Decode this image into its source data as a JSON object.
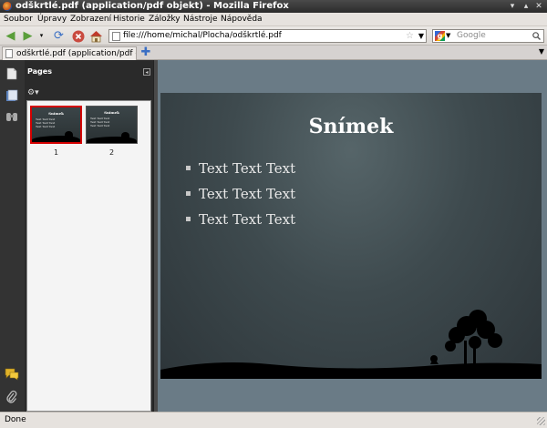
{
  "window": {
    "title": "odškrtlé.pdf (application/pdf objekt) - Mozilla Firefox"
  },
  "menu": {
    "items": [
      "Soubor",
      "Úpravy",
      "Zobrazení",
      "Historie",
      "Záložky",
      "Nástroje",
      "Nápověda"
    ]
  },
  "navigation": {
    "url": "file:///home/michal/Plocha/odškrtlé.pdf",
    "search_placeholder": "Google"
  },
  "tabs": [
    {
      "label": "odškrtlé.pdf (application/pdf obj..."
    }
  ],
  "sidebar": {
    "header": "Pages",
    "thumbnails": [
      {
        "number": "1",
        "selected": true
      },
      {
        "number": "2",
        "selected": false
      }
    ],
    "thumbnail_title": "Snímek",
    "thumbnail_bullet": "Text Text Text"
  },
  "slide": {
    "title": "Snímek",
    "bullets": [
      "Text Text Text",
      "Text Text Text",
      "Text Text Text"
    ]
  },
  "status": {
    "text": "Done"
  },
  "colors": {
    "content_background": "#6a7b86",
    "selected_thumbnail_border": "#d40000",
    "slide_background": "#3e4a4e"
  }
}
